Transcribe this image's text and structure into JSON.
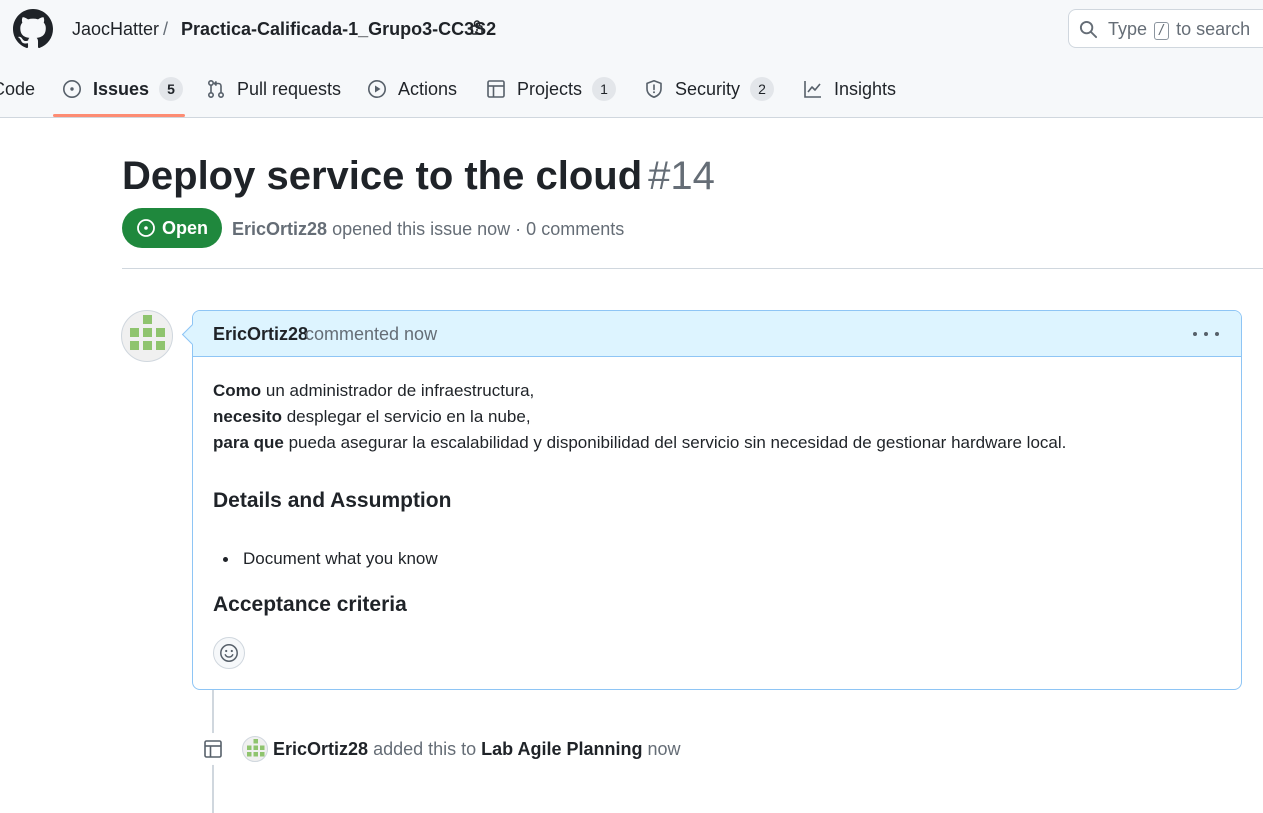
{
  "header": {
    "owner": "JaocHatter",
    "separator": "/",
    "repo": "Practica-Calificada-1_Grupo3-CC3S2",
    "search": {
      "prefix": "Type",
      "key": "/",
      "suffix": "to search"
    }
  },
  "nav": [
    {
      "label": "Code",
      "icon": "code-icon"
    },
    {
      "label": "Issues",
      "count": "5",
      "icon": "issue-opened-icon",
      "selected": true
    },
    {
      "label": "Pull requests",
      "icon": "git-pull-request-icon"
    },
    {
      "label": "Actions",
      "icon": "play-icon"
    },
    {
      "label": "Projects",
      "count": "1",
      "icon": "table-icon"
    },
    {
      "label": "Security",
      "count": "2",
      "icon": "shield-icon"
    },
    {
      "label": "Insights",
      "icon": "graph-icon"
    }
  ],
  "issue": {
    "title": "Deploy service to the cloud",
    "number": "#14",
    "state": "Open",
    "author": "EricOrtiz28",
    "meta_text": "opened this issue now · 0 comments"
  },
  "comment": {
    "author": "EricOrtiz28",
    "action": "commented now",
    "story": [
      {
        "bold": "Como",
        "text": "un administrador de infraestructura,"
      },
      {
        "bold": "necesito",
        "text": "desplegar el servicio en la nube,"
      },
      {
        "bold": "para que",
        "text": "pueda asegurar la escalabilidad y disponibilidad del servicio sin necesidad de gestionar hardware local."
      }
    ],
    "details_heading": "Details and Assumption",
    "details_items": [
      "Document what you know"
    ],
    "acceptance_heading": "Acceptance criteria"
  },
  "timeline": {
    "actor": "EricOrtiz28",
    "action": "added this to",
    "project": "Lab Agile Planning",
    "time": "now"
  },
  "colors": {
    "open_green": "#1f883d",
    "comment_header_bg": "#ddf4ff",
    "comment_border": "#8ec5f5",
    "tab_underline": "#fd8c73",
    "identicon": "#8fc46e"
  }
}
